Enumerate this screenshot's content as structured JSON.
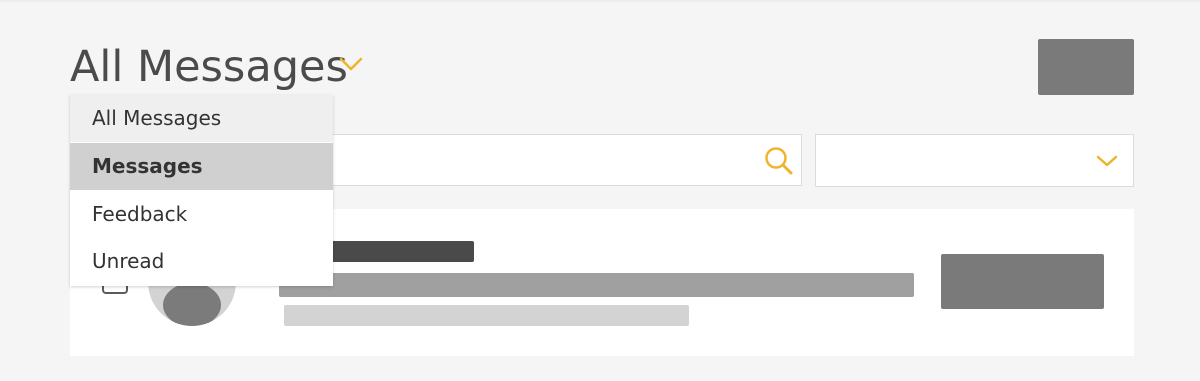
{
  "header": {
    "title": "All Messages",
    "chevron_icon": "chevron-down-icon",
    "accent_color": "#f0b32e"
  },
  "filter_menu": {
    "selected": "Messages",
    "options": [
      "All Messages",
      "Messages",
      "Feedback",
      "Unread"
    ]
  },
  "search": {
    "icon": "search-icon",
    "value": "",
    "placeholder": ""
  },
  "filter_select": {
    "value": "",
    "icon": "chevron-down-icon"
  }
}
